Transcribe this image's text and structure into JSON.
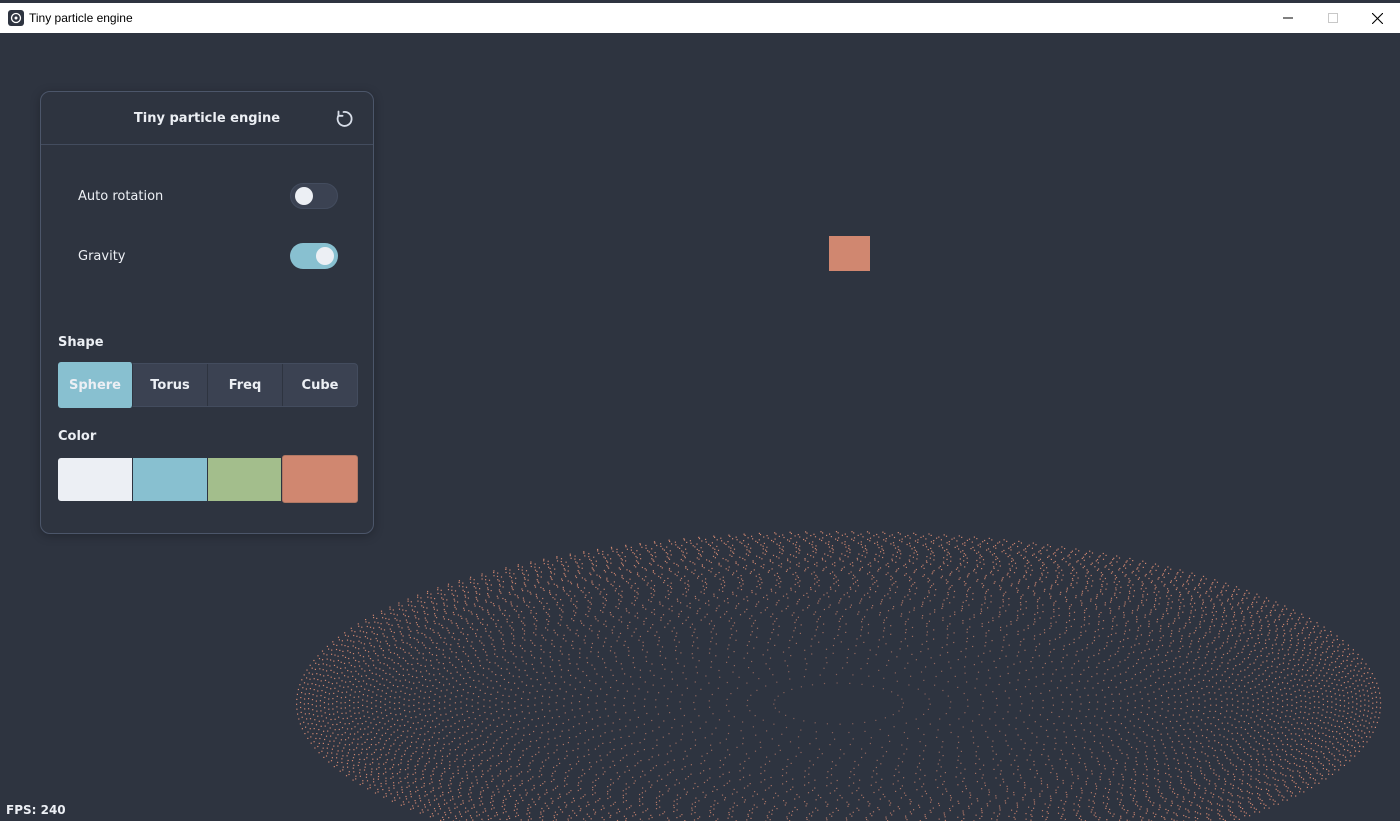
{
  "window": {
    "title": "Tiny particle engine",
    "controls": [
      "minimize-icon",
      "maximize-icon",
      "close-icon"
    ]
  },
  "panel": {
    "title": "Tiny particle engine",
    "reset_icon": "reset-icon",
    "toggles": [
      {
        "label": "Auto rotation",
        "on": false
      },
      {
        "label": "Gravity",
        "on": true
      }
    ],
    "shape": {
      "label": "Shape",
      "options": [
        "Sphere",
        "Torus",
        "Freq",
        "Cube"
      ],
      "selected": "Sphere"
    },
    "color": {
      "label": "Color",
      "options": [
        "#eceff4",
        "#88c0d0",
        "#a3be8c",
        "#d08770"
      ],
      "selected": "#d08770"
    }
  },
  "colors": {
    "background": "#2e3440",
    "accent": "#88c0d0",
    "particle": "#d08770"
  },
  "status": {
    "fps": "FPS: 240"
  }
}
